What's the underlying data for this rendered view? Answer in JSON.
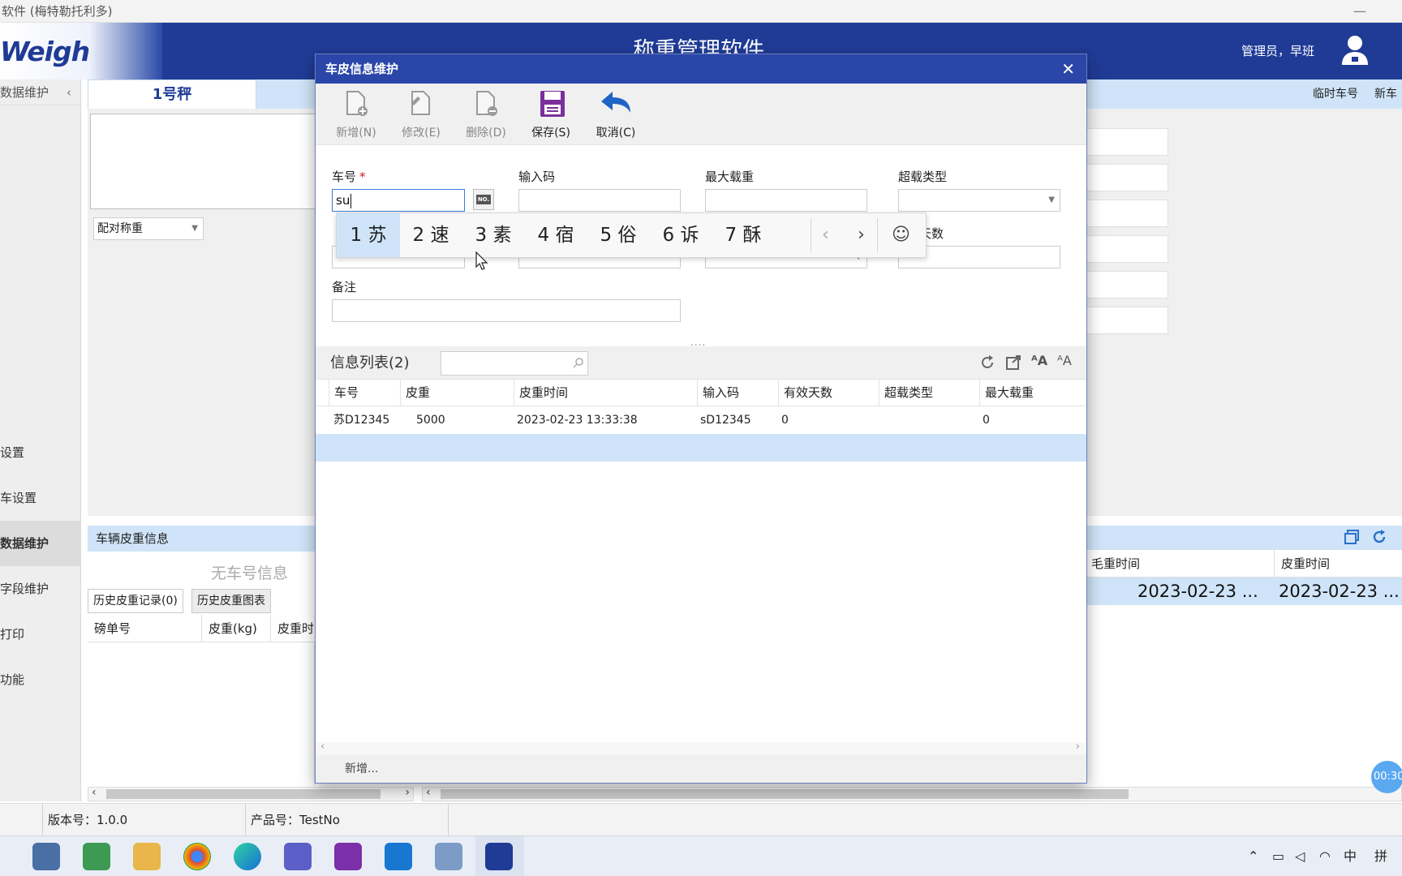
{
  "window": {
    "title": "软件 (梅特勒托利多)",
    "minimize": "—"
  },
  "header": {
    "logo": "Weigh",
    "title": "称重管理软件",
    "user": "管理员，早班"
  },
  "sidebar": {
    "head_label": "数据维护",
    "items": [
      "设置",
      "车设置",
      "数据维护",
      "字段维护",
      "打印",
      "功能"
    ]
  },
  "scale": {
    "tab": "1号秤",
    "right_labels": [
      "临时车号",
      "新车号"
    ],
    "mode_combo": "配对称重"
  },
  "lower": {
    "vehicle_tare_label": "车辆皮重信息",
    "no_car_text": "无车号信息",
    "tabs": [
      "历史皮重记录(0)",
      "历史皮重图表"
    ],
    "history_columns": [
      "磅单号",
      "皮重(kg)",
      "皮重时间"
    ],
    "right_columns": [
      "毛重时间",
      "皮重时间"
    ],
    "right_row": [
      "2023-02-23 ...",
      "2023-02-23 ..."
    ]
  },
  "status": {
    "version": "版本号：1.0.0",
    "product": "产品号：TestNo"
  },
  "timer": "00:30",
  "tray": {
    "ime": "中",
    "grid": "拼"
  },
  "modal": {
    "title": "车皮信息维护",
    "close": "✕",
    "toolbar": [
      {
        "label": "新增(N)",
        "enabled": false
      },
      {
        "label": "修改(E)",
        "enabled": false
      },
      {
        "label": "删除(D)",
        "enabled": false
      },
      {
        "label": "保存(S)",
        "enabled": true
      },
      {
        "label": "取消(C)",
        "enabled": true
      }
    ],
    "form": {
      "plate_label": "车号",
      "required_mark": "*",
      "plate_value": "su",
      "input_code_label": "输入码",
      "max_load_label": "最大载重",
      "overload_type_label": "超载类型",
      "valid_days_label": "天数",
      "remark_label": "备注",
      "no_button": "NO."
    },
    "ime": {
      "candidates": [
        "1 苏",
        "2 速",
        "3 素",
        "4 宿",
        "5 俗",
        "6 诉",
        "7 酥"
      ],
      "prev": "‹",
      "next": "›",
      "emoji": "☺"
    },
    "list": {
      "title": "信息列表(2)",
      "columns": [
        "车号",
        "皮重",
        "皮重时间",
        "输入码",
        "有效天数",
        "超载类型",
        "最大载重"
      ],
      "rows": [
        [
          "苏D12345",
          "5000",
          "2023-02-23 13:33:38",
          "sD12345",
          "0",
          "",
          "0"
        ]
      ]
    },
    "footer": "新增..."
  }
}
